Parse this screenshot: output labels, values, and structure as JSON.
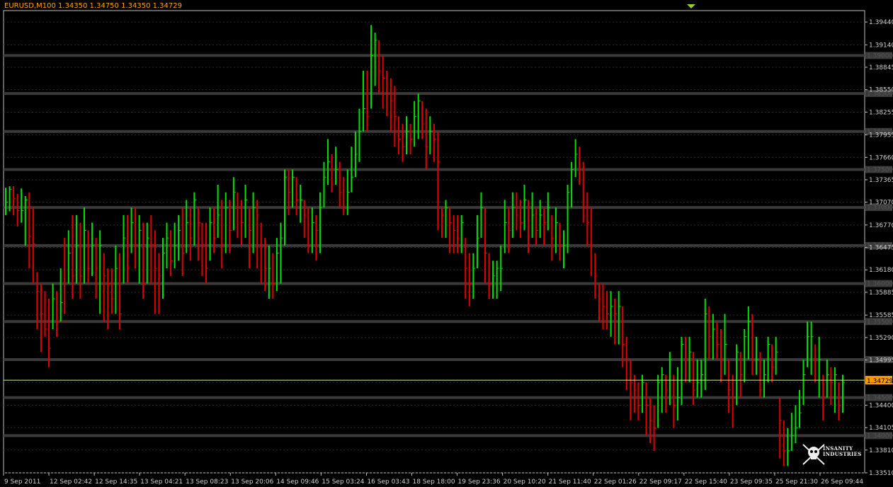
{
  "header": {
    "title": "EURUSD,M100 1.34350 1.34750 1.34350 1.34729"
  },
  "colors": {
    "bull": "#00e000",
    "bear": "#e00000",
    "background": "#000000",
    "grid": "#2c2c2c",
    "level": "#3a3a3a",
    "bid_line": "#c8ff64",
    "text": "#d0d0d0",
    "current_price_tag": "#ff9900"
  },
  "logo": {
    "text": "INSANITY INDUSTRIES",
    "icon": "pirate-skull-icon"
  },
  "chart_data": {
    "type": "bar",
    "symbol": "EURUSD",
    "timeframe": "M100",
    "ylim": [
      1.3351,
      1.3959
    ],
    "y_ticks": [
      "1.39440",
      "1.39140",
      "1.38845",
      "1.38550",
      "1.38255",
      "1.37955",
      "1.37660",
      "1.37365",
      "1.37070",
      "1.36770",
      "1.36475",
      "1.36180",
      "1.35885",
      "1.35585",
      "1.35290",
      "1.34995",
      "1.34700",
      "1.34400",
      "1.34105",
      "1.33810",
      "1.33510"
    ],
    "level_lines": [
      1.39,
      1.385,
      1.38,
      1.375,
      1.37,
      1.365,
      1.36,
      1.355,
      1.35,
      1.345,
      1.34
    ],
    "level_labels": [
      "1.39000",
      "1.38500",
      "1.38000",
      "1.37500",
      "1.37000",
      "1.36500",
      "1.36000",
      "1.35500",
      "1.35000",
      "1.34500",
      "1.34000"
    ],
    "current_price": 1.34729,
    "current_price_label": "1.34729",
    "x_labels": [
      "9 Sep 2011",
      "12 Sep 02:42",
      "12 Sep 14:35",
      "13 Sep 04:21",
      "13 Sep 08:23",
      "13 Sep 20:06",
      "14 Sep 09:46",
      "15 Sep 03:24",
      "16 Sep 03:43",
      "18 Sep 18:00",
      "19 Sep 23:36",
      "20 Sep 10:20",
      "21 Sep 11:40",
      "22 Sep 01:26",
      "22 Sep 09:17",
      "22 Sep 15:40",
      "23 Sep 09:35",
      "25 Sep 21:30",
      "26 Sep 09:44"
    ],
    "close": [
      1.3707,
      1.3724,
      1.3712,
      1.3696,
      1.3696,
      1.371,
      1.3662,
      1.3652,
      1.359,
      1.356,
      1.354,
      1.3515,
      1.358,
      1.355,
      1.3575,
      1.355,
      1.364,
      1.361,
      1.365,
      1.361,
      1.367,
      1.362,
      1.365,
      1.362,
      1.365,
      1.361,
      1.36,
      1.358,
      1.362,
      1.356,
      1.366,
      1.362,
      1.368,
      1.365,
      1.367,
      1.36,
      1.366,
      1.365,
      1.362,
      1.361,
      1.364,
      1.366,
      1.363,
      1.365,
      1.367,
      1.364,
      1.368,
      1.366,
      1.371,
      1.368,
      1.365,
      1.362,
      1.368,
      1.366,
      1.369,
      1.365,
      1.37,
      1.367,
      1.372,
      1.37,
      1.368,
      1.371,
      1.367,
      1.37,
      1.369,
      1.365,
      1.362,
      1.362,
      1.36,
      1.364,
      1.366,
      1.374,
      1.372,
      1.374,
      1.371,
      1.371,
      1.369,
      1.365,
      1.368,
      1.367,
      1.37,
      1.374,
      1.376,
      1.373,
      1.375,
      1.372,
      1.37,
      1.372,
      1.374,
      1.377,
      1.38,
      1.383,
      1.382,
      1.39,
      1.392,
      1.388,
      1.387,
      1.385,
      1.384,
      1.382,
      1.379,
      1.378,
      1.38,
      1.379,
      1.382,
      1.384,
      1.381,
      1.378,
      1.38,
      1.379,
      1.376,
      1.369,
      1.37,
      1.368,
      1.367,
      1.366,
      1.368,
      1.362,
      1.36,
      1.362,
      1.366,
      1.37,
      1.364,
      1.36,
      1.361,
      1.362,
      1.362,
      1.368,
      1.367,
      1.37,
      1.369,
      1.368,
      1.371,
      1.365,
      1.369,
      1.367,
      1.369,
      1.368,
      1.37,
      1.366,
      1.368,
      1.365,
      1.365,
      1.372,
      1.375,
      1.377,
      1.375,
      1.37,
      1.368,
      1.365,
      1.361,
      1.358,
      1.357,
      1.356,
      1.357,
      1.356,
      1.357,
      1.352,
      1.35,
      1.347,
      1.346,
      1.344,
      1.347,
      1.344,
      1.342,
      1.341,
      1.347,
      1.348,
      1.346,
      1.35,
      1.344,
      1.345,
      1.352,
      1.35,
      1.351,
      1.346,
      1.347,
      1.348,
      1.356,
      1.353,
      1.354,
      1.352,
      1.35,
      1.352,
      1.346,
      1.345,
      1.351,
      1.348,
      1.353,
      1.355,
      1.35,
      1.35,
      1.346,
      1.348,
      1.352,
      1.349,
      1.351,
      1.342,
      1.338,
      1.338,
      1.34,
      1.341,
      1.343,
      1.348,
      1.353,
      1.353,
      1.35,
      1.35,
      1.345,
      1.348,
      1.347,
      1.348,
      1.344,
      1.347
    ],
    "range": [
      [
        1.3726,
        1.369
      ],
      [
        1.3728,
        1.3695
      ],
      [
        1.3728,
        1.369
      ],
      [
        1.3718,
        1.3675
      ],
      [
        1.3725,
        1.368
      ],
      [
        1.3715,
        1.365
      ],
      [
        1.372,
        1.362
      ],
      [
        1.37,
        1.36
      ],
      [
        1.3615,
        1.354
      ],
      [
        1.36,
        1.351
      ],
      [
        1.359,
        1.353
      ],
      [
        1.358,
        1.349
      ],
      [
        1.36,
        1.354
      ],
      [
        1.359,
        1.353
      ],
      [
        1.362,
        1.355
      ],
      [
        1.366,
        1.356
      ],
      [
        1.367,
        1.36
      ],
      [
        1.369,
        1.358
      ],
      [
        1.369,
        1.36
      ],
      [
        1.368,
        1.358
      ],
      [
        1.37,
        1.36
      ],
      [
        1.367,
        1.36
      ],
      [
        1.368,
        1.361
      ],
      [
        1.366,
        1.358
      ],
      [
        1.367,
        1.356
      ],
      [
        1.364,
        1.355
      ],
      [
        1.362,
        1.354
      ],
      [
        1.362,
        1.356
      ],
      [
        1.365,
        1.356
      ],
      [
        1.364,
        1.354
      ],
      [
        1.369,
        1.36
      ],
      [
        1.369,
        1.36
      ],
      [
        1.37,
        1.364
      ],
      [
        1.37,
        1.362
      ],
      [
        1.369,
        1.36
      ],
      [
        1.368,
        1.358
      ],
      [
        1.368,
        1.36
      ],
      [
        1.369,
        1.36
      ],
      [
        1.367,
        1.356
      ],
      [
        1.364,
        1.356
      ],
      [
        1.366,
        1.358
      ],
      [
        1.368,
        1.362
      ],
      [
        1.367,
        1.361
      ],
      [
        1.368,
        1.362
      ],
      [
        1.369,
        1.363
      ],
      [
        1.37,
        1.361
      ],
      [
        1.371,
        1.364
      ],
      [
        1.37,
        1.363
      ],
      [
        1.372,
        1.365
      ],
      [
        1.37,
        1.363
      ],
      [
        1.368,
        1.361
      ],
      [
        1.368,
        1.36
      ],
      [
        1.37,
        1.363
      ],
      [
        1.37,
        1.364
      ],
      [
        1.373,
        1.366
      ],
      [
        1.371,
        1.362
      ],
      [
        1.372,
        1.364
      ],
      [
        1.371,
        1.364
      ],
      [
        1.374,
        1.367
      ],
      [
        1.372,
        1.366
      ],
      [
        1.371,
        1.365
      ],
      [
        1.373,
        1.366
      ],
      [
        1.37,
        1.362
      ],
      [
        1.372,
        1.364
      ],
      [
        1.371,
        1.362
      ],
      [
        1.368,
        1.36
      ],
      [
        1.366,
        1.359
      ],
      [
        1.365,
        1.358
      ],
      [
        1.364,
        1.358
      ],
      [
        1.366,
        1.359
      ],
      [
        1.368,
        1.36
      ],
      [
        1.375,
        1.365
      ],
      [
        1.375,
        1.369
      ],
      [
        1.375,
        1.37
      ],
      [
        1.374,
        1.369
      ],
      [
        1.373,
        1.368
      ],
      [
        1.371,
        1.366
      ],
      [
        1.37,
        1.364
      ],
      [
        1.37,
        1.364
      ],
      [
        1.369,
        1.363
      ],
      [
        1.372,
        1.364
      ],
      [
        1.376,
        1.37
      ],
      [
        1.379,
        1.373
      ],
      [
        1.377,
        1.372
      ],
      [
        1.378,
        1.373
      ],
      [
        1.376,
        1.37
      ],
      [
        1.374,
        1.369
      ],
      [
        1.375,
        1.369
      ],
      [
        1.378,
        1.372
      ],
      [
        1.38,
        1.374
      ],
      [
        1.383,
        1.376
      ],
      [
        1.388,
        1.38
      ],
      [
        1.388,
        1.38
      ],
      [
        1.394,
        1.383
      ],
      [
        1.393,
        1.386
      ],
      [
        1.392,
        1.385
      ],
      [
        1.39,
        1.383
      ],
      [
        1.388,
        1.382
      ],
      [
        1.387,
        1.38
      ],
      [
        1.386,
        1.378
      ],
      [
        1.382,
        1.377
      ],
      [
        1.381,
        1.376
      ],
      [
        1.382,
        1.377
      ],
      [
        1.381,
        1.377
      ],
      [
        1.384,
        1.378
      ],
      [
        1.385,
        1.379
      ],
      [
        1.384,
        1.379
      ],
      [
        1.383,
        1.375
      ],
      [
        1.382,
        1.377
      ],
      [
        1.381,
        1.376
      ],
      [
        1.38,
        1.367
      ],
      [
        1.37,
        1.366
      ],
      [
        1.371,
        1.366
      ],
      [
        1.37,
        1.364
      ],
      [
        1.369,
        1.364
      ],
      [
        1.369,
        1.364
      ],
      [
        1.369,
        1.364
      ],
      [
        1.366,
        1.358
      ],
      [
        1.364,
        1.357
      ],
      [
        1.364,
        1.358
      ],
      [
        1.369,
        1.362
      ],
      [
        1.372,
        1.366
      ],
      [
        1.37,
        1.36
      ],
      [
        1.364,
        1.358
      ],
      [
        1.363,
        1.358
      ],
      [
        1.363,
        1.358
      ],
      [
        1.365,
        1.359
      ],
      [
        1.371,
        1.364
      ],
      [
        1.37,
        1.364
      ],
      [
        1.372,
        1.366
      ],
      [
        1.372,
        1.367
      ],
      [
        1.371,
        1.366
      ],
      [
        1.373,
        1.367
      ],
      [
        1.371,
        1.364
      ],
      [
        1.372,
        1.366
      ],
      [
        1.37,
        1.365
      ],
      [
        1.371,
        1.366
      ],
      [
        1.37,
        1.365
      ],
      [
        1.372,
        1.367
      ],
      [
        1.369,
        1.363
      ],
      [
        1.37,
        1.364
      ],
      [
        1.368,
        1.363
      ],
      [
        1.367,
        1.362
      ],
      [
        1.373,
        1.364
      ],
      [
        1.376,
        1.37
      ],
      [
        1.379,
        1.374
      ],
      [
        1.378,
        1.373
      ],
      [
        1.376,
        1.368
      ],
      [
        1.372,
        1.365
      ],
      [
        1.37,
        1.361
      ],
      [
        1.364,
        1.358
      ],
      [
        1.36,
        1.355
      ],
      [
        1.36,
        1.354
      ],
      [
        1.359,
        1.354
      ],
      [
        1.359,
        1.353
      ],
      [
        1.358,
        1.352
      ],
      [
        1.359,
        1.352
      ],
      [
        1.357,
        1.349
      ],
      [
        1.353,
        1.346
      ],
      [
        1.35,
        1.342
      ],
      [
        1.348,
        1.343
      ],
      [
        1.347,
        1.342
      ],
      [
        1.348,
        1.343
      ],
      [
        1.347,
        1.34
      ],
      [
        1.345,
        1.339
      ],
      [
        1.344,
        1.338
      ],
      [
        1.348,
        1.341
      ],
      [
        1.349,
        1.343
      ],
      [
        1.348,
        1.343
      ],
      [
        1.351,
        1.344
      ],
      [
        1.348,
        1.341
      ],
      [
        1.349,
        1.342
      ],
      [
        1.353,
        1.344
      ],
      [
        1.353,
        1.347
      ],
      [
        1.353,
        1.347
      ],
      [
        1.351,
        1.344
      ],
      [
        1.35,
        1.345
      ],
      [
        1.35,
        1.345
      ],
      [
        1.358,
        1.346
      ],
      [
        1.357,
        1.35
      ],
      [
        1.356,
        1.35
      ],
      [
        1.355,
        1.35
      ],
      [
        1.354,
        1.347
      ],
      [
        1.356,
        1.348
      ],
      [
        1.35,
        1.343
      ],
      [
        1.348,
        1.341
      ],
      [
        1.352,
        1.344
      ],
      [
        1.351,
        1.345
      ],
      [
        1.354,
        1.347
      ],
      [
        1.357,
        1.35
      ],
      [
        1.356,
        1.348
      ],
      [
        1.353,
        1.348
      ],
      [
        1.351,
        1.345
      ],
      [
        1.35,
        1.345
      ],
      [
        1.353,
        1.347
      ],
      [
        1.352,
        1.347
      ],
      [
        1.353,
        1.348
      ],
      [
        1.345,
        1.337
      ],
      [
        1.342,
        1.336
      ],
      [
        1.341,
        1.336
      ],
      [
        1.343,
        1.338
      ],
      [
        1.344,
        1.339
      ],
      [
        1.346,
        1.341
      ],
      [
        1.35,
        1.344
      ],
      [
        1.355,
        1.349
      ],
      [
        1.355,
        1.348
      ],
      [
        1.352,
        1.347
      ],
      [
        1.353,
        1.345
      ],
      [
        1.348,
        1.342
      ],
      [
        1.35,
        1.345
      ],
      [
        1.349,
        1.344
      ],
      [
        1.349,
        1.343
      ],
      [
        1.347,
        1.342
      ],
      [
        1.348,
        1.343
      ]
    ]
  }
}
